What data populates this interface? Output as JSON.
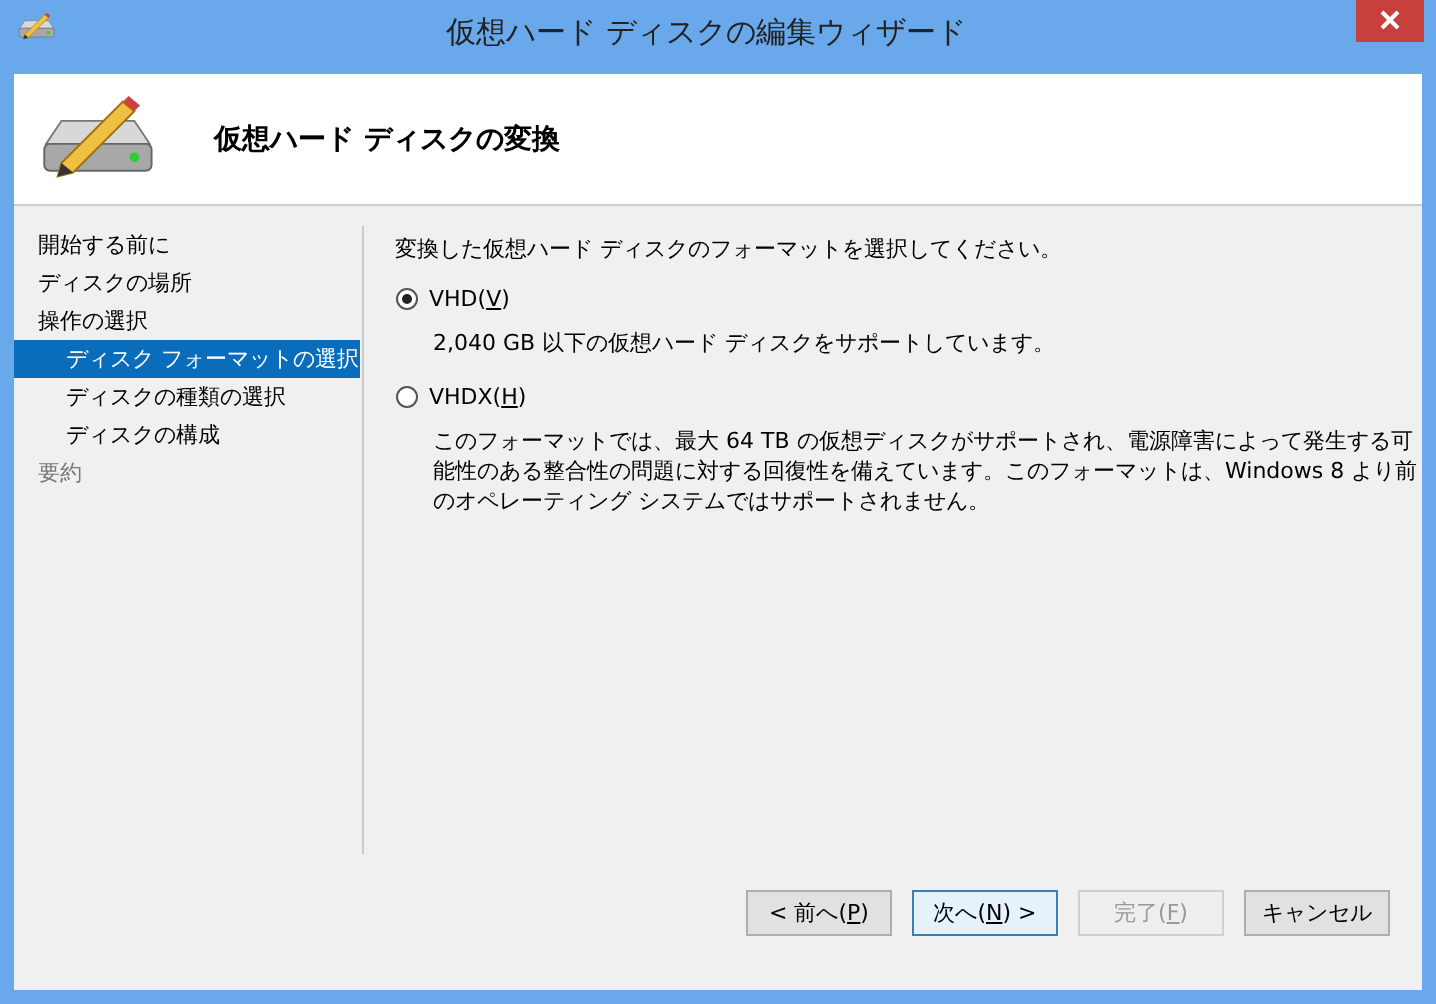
{
  "window": {
    "title": "仮想ハード ディスクの編集ウィザード"
  },
  "header": {
    "title": "仮想ハード ディスクの変換"
  },
  "steps": [
    {
      "label": "開始する前に",
      "selected": false,
      "disabled": false
    },
    {
      "label": "ディスクの場所",
      "selected": false,
      "disabled": false
    },
    {
      "label": "操作の選択",
      "selected": false,
      "disabled": false,
      "children": [
        {
          "label": "ディスク フォーマットの選択",
          "selected": true,
          "disabled": false
        },
        {
          "label": "ディスクの種類の選択",
          "selected": false,
          "disabled": false
        },
        {
          "label": "ディスクの構成",
          "selected": false,
          "disabled": false
        }
      ]
    },
    {
      "label": "要約",
      "selected": false,
      "disabled": true
    }
  ],
  "prompt": "変換した仮想ハード ディスクのフォーマットを選択してください。",
  "options": [
    {
      "label_before": "VHD(",
      "access_key": "V",
      "label_after": ")",
      "selected": true,
      "description": "2,040 GB 以下の仮想ハード ディスクをサポートしています。"
    },
    {
      "label_before": "VHDX(",
      "access_key": "H",
      "label_after": ")",
      "selected": false,
      "description": "このフォーマットでは、最大 64 TB の仮想ディスクがサポートされ、電源障害によって発生する可能性のある整合性の問題に対する回復性を備えています。このフォーマットは、Windows 8 より前のオペレーティング システムではサポートされません。"
    }
  ],
  "buttons": [
    {
      "label_before": "< 前へ(",
      "access_key": "P",
      "label_after": ")",
      "default": false,
      "disabled": false
    },
    {
      "label_before": "次へ(",
      "access_key": "N",
      "label_after": ") >",
      "default": true,
      "disabled": false
    },
    {
      "label_before": "完了(",
      "access_key": "F",
      "label_after": ")",
      "default": false,
      "disabled": true
    },
    {
      "label_before": "キャンセル",
      "default": false,
      "disabled": false
    }
  ]
}
